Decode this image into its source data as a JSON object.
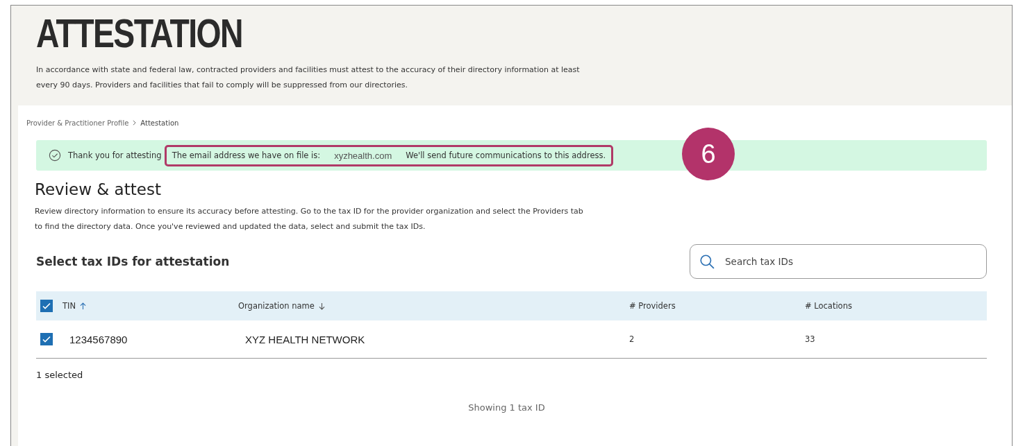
{
  "header": {
    "title": "ATTESTATION",
    "intro": "In accordance with state and federal law, contracted providers and facilities must attest to the accuracy of their directory information at least every 90 days. Providers and facilities that fail to comply will be suppressed from our directories."
  },
  "breadcrumb": [
    "Provider & Practitioner Profile",
    "Attestation"
  ],
  "alert": {
    "thanks": "Thank you for attesting",
    "email_label": "The email address we have on file is:",
    "email": "xyzhealth.com",
    "note": "We'll send future communications to this address.",
    "callout": "6"
  },
  "review": {
    "title": "Review & attest",
    "text": "Review directory information to ensure its accuracy before attesting. Go to the tax ID for the provider organization and select the Providers tab to find the directory data. Once you've reviewed and updated the data, select and submit the tax IDs."
  },
  "table_section": {
    "title": "Select tax IDs for attestation",
    "search": {
      "placeholder": "Search tax IDs"
    }
  },
  "table": {
    "all_checked": true,
    "columns": [
      {
        "label": "TIN",
        "sort_ascending": true
      },
      {
        "label": "Organization name",
        "sort_ascending": false
      },
      {
        "label": "# Providers"
      },
      {
        "label": "# Locations"
      }
    ],
    "rows": [
      {
        "checked": true,
        "cells": [
          "1234567890",
          "XYZ HEALTH NETWORK",
          "2",
          "33"
        ]
      }
    ]
  },
  "selected_count": "1 selected",
  "footer": "Showing 1 tax ID"
}
